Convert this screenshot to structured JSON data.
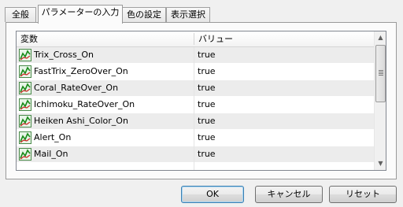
{
  "tabs": [
    {
      "label": "全般"
    },
    {
      "label": "パラメーターの入力"
    },
    {
      "label": "色の設定"
    },
    {
      "label": "表示選択"
    }
  ],
  "active_tab": "パラメーターの入力",
  "table": {
    "columns": [
      "変数",
      "バリュー"
    ],
    "rows": [
      {
        "name": "Trix_Cross_On",
        "value": "true",
        "icon": "indicator-param-icon"
      },
      {
        "name": "FastTrix_ZeroOver_On",
        "value": "true",
        "icon": "indicator-param-icon"
      },
      {
        "name": "Coral_RateOver_On",
        "value": "true",
        "icon": "indicator-param-icon"
      },
      {
        "name": "Ichimoku_RateOver_On",
        "value": "true",
        "icon": "indicator-param-icon"
      },
      {
        "name": "Heiken Ashi_Color_On",
        "value": "true",
        "icon": "indicator-param-icon"
      },
      {
        "name": "Alert_On",
        "value": "true",
        "icon": "indicator-param-icon"
      },
      {
        "name": "Mail_On",
        "value": "true",
        "icon": "indicator-param-icon"
      }
    ]
  },
  "buttons": {
    "ok": "OK",
    "cancel": "キャンセル",
    "reset": "リセット"
  }
}
